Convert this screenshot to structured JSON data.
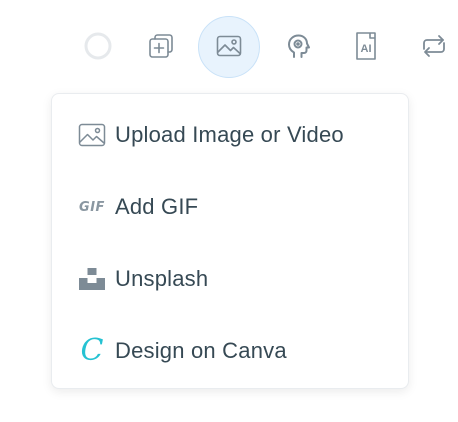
{
  "toolbar": {
    "icons": [
      {
        "name": "circle-progress-icon"
      },
      {
        "name": "add-post-icon"
      },
      {
        "name": "image-icon",
        "active": true
      },
      {
        "name": "ai-assistant-icon"
      },
      {
        "name": "ai-text-icon",
        "label": "AI"
      },
      {
        "name": "repost-icon"
      }
    ]
  },
  "menu": {
    "items": [
      {
        "label": "Upload Image or Video",
        "icon": "image-icon"
      },
      {
        "label": "Add GIF",
        "icon": "gif-icon",
        "icon_text": "GIF"
      },
      {
        "label": "Unsplash",
        "icon": "unsplash-icon"
      },
      {
        "label": "Design on Canva",
        "icon": "canva-icon",
        "icon_text": "C"
      }
    ]
  },
  "colors": {
    "icon": "#7d8b96",
    "active_bg": "#e8f3fd",
    "label": "#364954",
    "canva": "#25c2d2"
  }
}
